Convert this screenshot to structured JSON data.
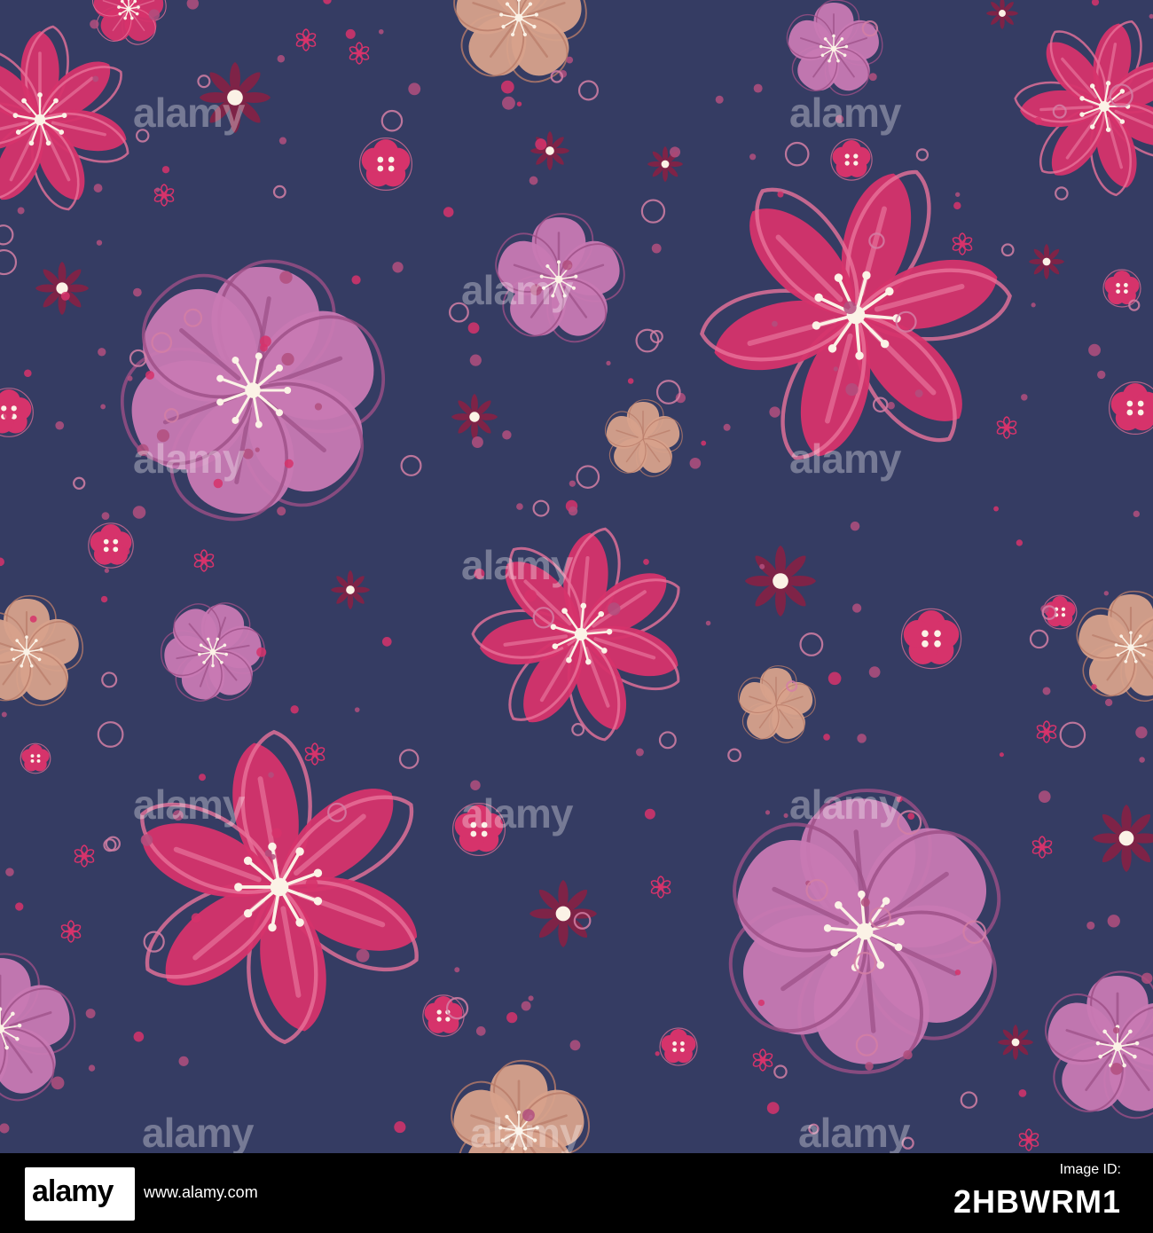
{
  "watermark": {
    "text": "alamy"
  },
  "footer": {
    "logo": "alamy",
    "site": "www.alamy.com",
    "id_label": "Image ID:",
    "image_id": "2HBWRM1"
  },
  "palette": {
    "background": "#353c63",
    "pink": "#d6336b",
    "pink_light": "#e8729a",
    "mauve": "#c879b3",
    "mauve_dark": "#9c4f86",
    "peach": "#d7a18b",
    "wine": "#7e2347",
    "dot": "#b24f7e",
    "center": "#fbf2e6",
    "ring": "#d47fa5"
  }
}
